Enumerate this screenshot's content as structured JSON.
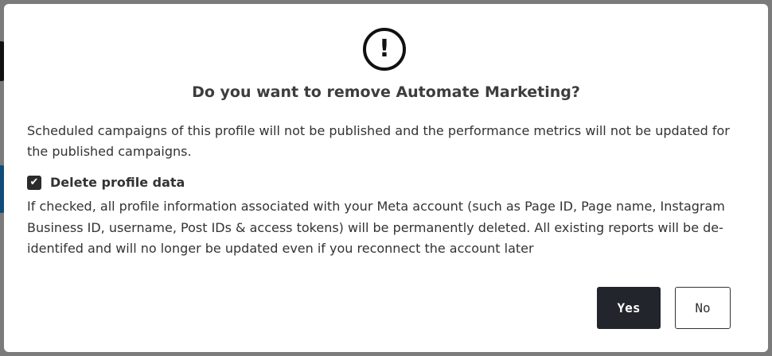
{
  "dialog": {
    "icon": "exclamation-icon",
    "title": "Do you want to remove Automate Marketing?",
    "description": "Scheduled campaigns of this profile will not be published and the performance metrics will not be updated for the published campaigns.",
    "checkbox": {
      "label": "Delete profile data",
      "checked": true
    },
    "note": "If checked, all profile information associated with your Meta account (such as Page ID, Page name, Instagram Business ID, username, Post IDs & access tokens) will be permanently deleted. All existing reports will be de-identifed and will no longer be updated even if you reconnect the account later",
    "buttons": {
      "yes_label": "Yes",
      "no_label": "No"
    }
  },
  "colors": {
    "overlay": "#7b7b7b",
    "primary_button": "#22252b",
    "text": "#333333"
  }
}
